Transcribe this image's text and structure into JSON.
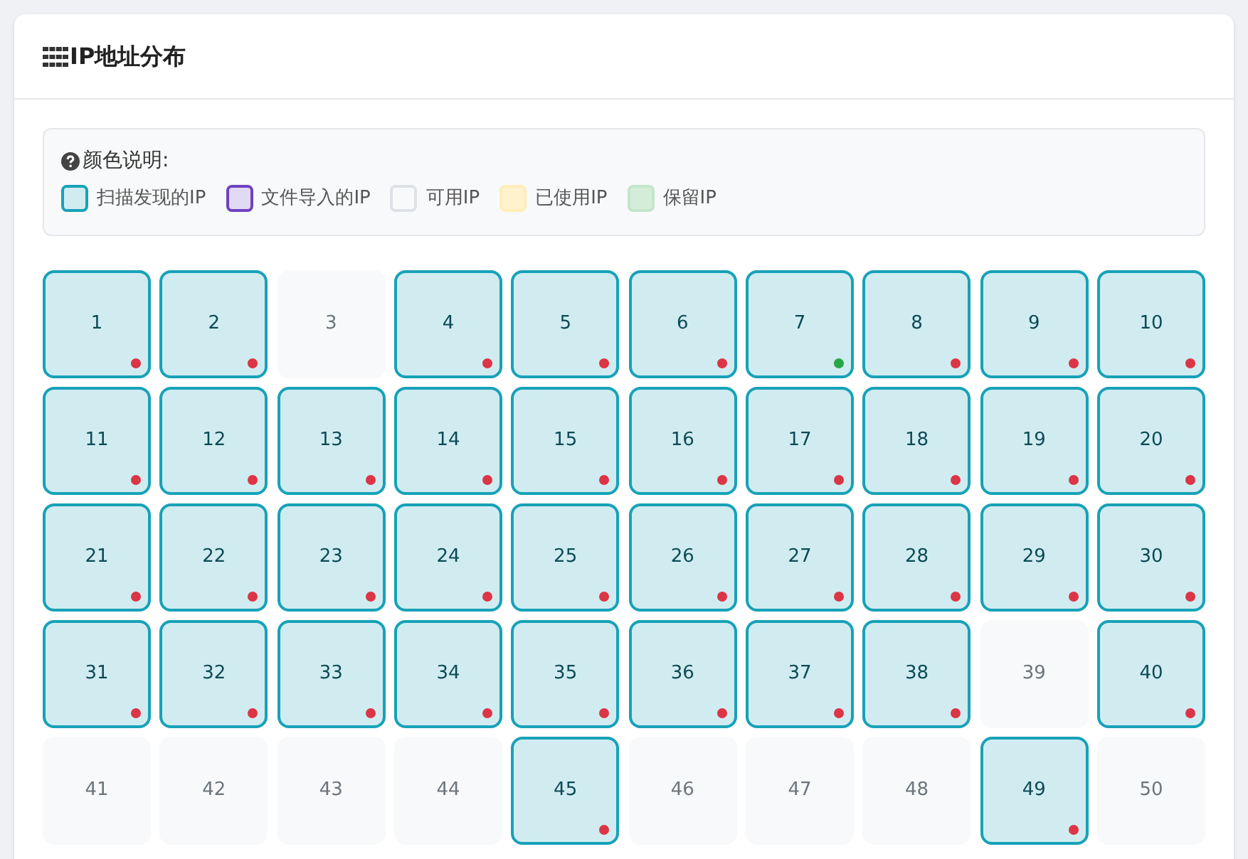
{
  "card": {
    "title": "IP地址分布"
  },
  "legend": {
    "title": "颜色说明:",
    "items": [
      {
        "kind": "scanned",
        "label": "扫描发现的IP"
      },
      {
        "kind": "imported",
        "label": "文件导入的IP"
      },
      {
        "kind": "available",
        "label": "可用IP"
      },
      {
        "kind": "used",
        "label": "已使用IP"
      },
      {
        "kind": "reserved",
        "label": "保留IP"
      }
    ]
  },
  "cells": [
    {
      "label": "1",
      "kind": "scanned",
      "color": "#dc3545"
    },
    {
      "label": "2",
      "kind": "scanned",
      "color": "#dc3545"
    },
    {
      "label": "3",
      "kind": "available"
    },
    {
      "label": "4",
      "kind": "scanned",
      "color": "#dc3545"
    },
    {
      "label": "5",
      "kind": "scanned",
      "color": "#dc3545"
    },
    {
      "label": "6",
      "kind": "scanned",
      "color": "#dc3545"
    },
    {
      "label": "7",
      "kind": "scanned",
      "color": "#28a745"
    },
    {
      "label": "8",
      "kind": "scanned",
      "color": "#dc3545"
    },
    {
      "label": "9",
      "kind": "scanned",
      "color": "#dc3545"
    },
    {
      "label": "10",
      "kind": "scanned",
      "color": "#dc3545"
    },
    {
      "label": "11",
      "kind": "scanned",
      "color": "#dc3545"
    },
    {
      "label": "12",
      "kind": "scanned",
      "color": "#dc3545"
    },
    {
      "label": "13",
      "kind": "scanned",
      "color": "#dc3545"
    },
    {
      "label": "14",
      "kind": "scanned",
      "color": "#dc3545"
    },
    {
      "label": "15",
      "kind": "scanned",
      "color": "#dc3545"
    },
    {
      "label": "16",
      "kind": "scanned",
      "color": "#dc3545"
    },
    {
      "label": "17",
      "kind": "scanned",
      "color": "#dc3545"
    },
    {
      "label": "18",
      "kind": "scanned",
      "color": "#dc3545"
    },
    {
      "label": "19",
      "kind": "scanned",
      "color": "#dc3545"
    },
    {
      "label": "20",
      "kind": "scanned",
      "color": "#dc3545"
    },
    {
      "label": "21",
      "kind": "scanned",
      "color": "#dc3545"
    },
    {
      "label": "22",
      "kind": "scanned",
      "color": "#dc3545"
    },
    {
      "label": "23",
      "kind": "scanned",
      "color": "#dc3545"
    },
    {
      "label": "24",
      "kind": "scanned",
      "color": "#dc3545"
    },
    {
      "label": "25",
      "kind": "scanned",
      "color": "#dc3545"
    },
    {
      "label": "26",
      "kind": "scanned",
      "color": "#dc3545"
    },
    {
      "label": "27",
      "kind": "scanned",
      "color": "#dc3545"
    },
    {
      "label": "28",
      "kind": "scanned",
      "color": "#dc3545"
    },
    {
      "label": "29",
      "kind": "scanned",
      "color": "#dc3545"
    },
    {
      "label": "30",
      "kind": "scanned",
      "color": "#dc3545"
    },
    {
      "label": "31",
      "kind": "scanned",
      "color": "#dc3545"
    },
    {
      "label": "32",
      "kind": "scanned",
      "color": "#dc3545"
    },
    {
      "label": "33",
      "kind": "scanned",
      "color": "#dc3545"
    },
    {
      "label": "34",
      "kind": "scanned",
      "color": "#dc3545"
    },
    {
      "label": "35",
      "kind": "scanned",
      "color": "#dc3545"
    },
    {
      "label": "36",
      "kind": "scanned",
      "color": "#dc3545"
    },
    {
      "label": "37",
      "kind": "scanned",
      "color": "#dc3545"
    },
    {
      "label": "38",
      "kind": "scanned",
      "color": "#dc3545"
    },
    {
      "label": "39",
      "kind": "available"
    },
    {
      "label": "40",
      "kind": "scanned",
      "color": "#dc3545"
    },
    {
      "label": "41",
      "kind": "available"
    },
    {
      "label": "42",
      "kind": "available"
    },
    {
      "label": "43",
      "kind": "available"
    },
    {
      "label": "44",
      "kind": "available"
    },
    {
      "label": "45",
      "kind": "scanned",
      "color": "#dc3545"
    },
    {
      "label": "46",
      "kind": "available"
    },
    {
      "label": "47",
      "kind": "available"
    },
    {
      "label": "48",
      "kind": "available"
    },
    {
      "label": "49",
      "kind": "scanned",
      "color": "#dc3545"
    },
    {
      "label": "50",
      "kind": "available"
    }
  ]
}
